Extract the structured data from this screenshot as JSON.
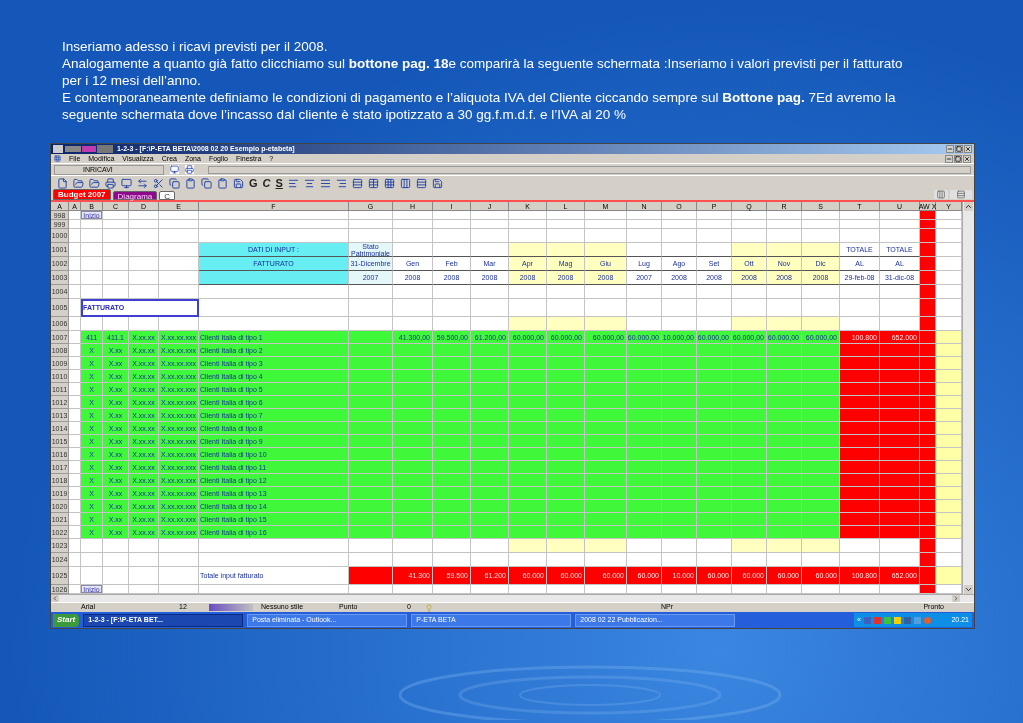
{
  "slide_text": [
    "Inseriamo adesso i ricavi previsti per il 2008.",
    "Analogamente a quanto già fatto clicchiamo sul **bottone pag. 18**e comparirà la seguente schermata :Inseriamo i valori previsti per il fatturato per i 12 mesi dell’anno.",
    "E contemporaneamente definiamo le condizioni di pagamento e l’aliquota IVA del Cliente ciccando sempre sul **Bottone pag.** 7Ed avremo la seguente schermata dove l’incasso dal cliente è stato ipotizzato a 30 gg.f.m.d.f. e l’IVA al 20 %"
  ],
  "window": {
    "title": "1-2-3 - [F:\\P-ETA BETA\\2008 02 20  Esempio p-etabeta]"
  },
  "menu": [
    "File",
    "Modifica",
    "Visualizza",
    "Crea",
    "Zona",
    "Foglio",
    "Finestra",
    "?"
  ],
  "name_box": {
    "value": "INRICAVI"
  },
  "toolbar": {
    "text_buttons": [
      "G",
      "C",
      "S"
    ]
  },
  "sheet_tabs": [
    {
      "label": "Budget 2007",
      "selected": true,
      "color": "#ff0000"
    },
    {
      "label": "Diagrama",
      "selected": false,
      "color": "#8a0a8a"
    },
    {
      "label": "C",
      "selected": false,
      "color": "#ffffff"
    }
  ],
  "corner": "A",
  "columns": [
    "A",
    "B",
    "C",
    "D",
    "E",
    "F",
    "G",
    "H",
    "I",
    "J",
    "K",
    "L",
    "M",
    "N",
    "O",
    "P",
    "Q",
    "R",
    "S",
    "T",
    "U",
    "AW X",
    "Y"
  ],
  "rows": [
    {
      "number": "998",
      "kind": "spacer",
      "button": "Inizio",
      "cells": {}
    },
    {
      "number": "999",
      "kind": "spacer",
      "cells": {}
    },
    {
      "number": "1000",
      "kind": "plain",
      "cells": {}
    },
    {
      "number": "1001",
      "kind": "head",
      "cells": {
        "F": "DATI DI INPUT  :",
        "G": "Stato Patrimoniale",
        "T": "TOTALE",
        "U": "TOTALE"
      }
    },
    {
      "number": "1002",
      "kind": "head",
      "cells": {
        "F": "FATTURATO",
        "G": "31-Dicembre",
        "H": "Gen",
        "I": "Feb",
        "J": "Mar",
        "K": "Apr",
        "L": "Mag",
        "M": "Giu",
        "N": "Lug",
        "O": "Ago",
        "P": "Set",
        "Q": "Ott",
        "R": "Nov",
        "S": "Dic",
        "T": "AL",
        "U": "AL"
      }
    },
    {
      "number": "1003",
      "kind": "head",
      "cells": {
        "G": "2007",
        "H": "2008",
        "I": "2008",
        "J": "2008",
        "K": "2008",
        "L": "2008",
        "M": "2008",
        "N": "2007",
        "O": "2008",
        "P": "2008",
        "Q": "2008",
        "R": "2008",
        "S": "2008",
        "T": "29-feb-08",
        "U": "31-dic-08"
      }
    },
    {
      "number": "1004",
      "kind": "plain",
      "cells": {}
    },
    {
      "number": "1005",
      "kind": "section",
      "cells": {
        "B": "FATTURATO"
      }
    },
    {
      "number": "1006",
      "kind": "gap",
      "cells": {}
    },
    {
      "number": "1007",
      "kind": "input",
      "cells": {
        "B": "411",
        "C": "411.1",
        "D": "X.xx.xx",
        "E": "X.xx.xx.xxx",
        "F": "Clienti Italia di tipo 1",
        "H": "41.300,00",
        "I": "59.500,00",
        "J": "61.200,00",
        "K": "60.000,00",
        "L": "60.000,00",
        "M": "60.000,00",
        "N": "60.000,00",
        "O": "10.000,00",
        "P": "60.000,00",
        "Q": "60.000,00",
        "R": "60.000,00",
        "S": "60.000,00",
        "T": "100.800",
        "U": "652.000"
      }
    },
    {
      "number": "1008",
      "kind": "input",
      "cells": {
        "B": "X",
        "C": "X.xx",
        "D": "X.xx.xx",
        "E": "X.xx.xx.xxx",
        "F": "Clienti Italia di tipo 2"
      }
    },
    {
      "number": "1009",
      "kind": "input",
      "cells": {
        "B": "X",
        "C": "X.xx",
        "D": "X.xx.xx",
        "E": "X.xx.xx.xxx",
        "F": "Clienti Italia di tipo 3"
      }
    },
    {
      "number": "1010",
      "kind": "input",
      "cells": {
        "B": "X",
        "C": "X.xx",
        "D": "X.xx.xx",
        "E": "X.xx.xx.xxx",
        "F": "Clienti Italia di tipo 4"
      }
    },
    {
      "number": "1011",
      "kind": "input",
      "cells": {
        "B": "X",
        "C": "X.xx",
        "D": "X.xx.xx",
        "E": "X.xx.xx.xxx",
        "F": "Clienti Italia di tipo 5"
      }
    },
    {
      "number": "1012",
      "kind": "input",
      "cells": {
        "B": "X",
        "C": "X.xx",
        "D": "X.xx.xx",
        "E": "X.xx.xx.xxx",
        "F": "Clienti Italia di tipo 6"
      }
    },
    {
      "number": "1013",
      "kind": "input",
      "cells": {
        "B": "X",
        "C": "X.xx",
        "D": "X.xx.xx",
        "E": "X.xx.xx.xxx",
        "F": "Clienti Italia di tipo 7"
      }
    },
    {
      "number": "1014",
      "kind": "input",
      "cells": {
        "B": "X",
        "C": "X.xx",
        "D": "X.xx.xx",
        "E": "X.xx.xx.xxx",
        "F": "Clienti Italia di tipo 8"
      }
    },
    {
      "number": "1015",
      "kind": "input",
      "cells": {
        "B": "X",
        "C": "X.xx",
        "D": "X.xx.xx",
        "E": "X.xx.xx.xxx",
        "F": "Clienti Italia di tipo 9"
      }
    },
    {
      "number": "1016",
      "kind": "input",
      "cells": {
        "B": "X",
        "C": "X.xx",
        "D": "X.xx.xx",
        "E": "X.xx.xx.xxx",
        "F": "Clienti Italia di tipo 10"
      }
    },
    {
      "number": "1017",
      "kind": "input",
      "cells": {
        "B": "X",
        "C": "X.xx",
        "D": "X.xx.xx",
        "E": "X.xx.xx.xxx",
        "F": "Clienti Italia di tipo 11"
      }
    },
    {
      "number": "1018",
      "kind": "input",
      "cells": {
        "B": "X",
        "C": "X.xx",
        "D": "X.xx.xx",
        "E": "X.xx.xx.xxx",
        "F": "Clienti Italia di tipo 12"
      }
    },
    {
      "number": "1019",
      "kind": "input",
      "cells": {
        "B": "X",
        "C": "X.xx",
        "D": "X.xx.xx",
        "E": "X.xx.xx.xxx",
        "F": "Clienti Italia di tipo 13"
      }
    },
    {
      "number": "1020",
      "kind": "input",
      "cells": {
        "B": "X",
        "C": "X.xx",
        "D": "X.xx.xx",
        "E": "X.xx.xx.xxx",
        "F": "Clienti Italia di tipo 14"
      }
    },
    {
      "number": "1021",
      "kind": "input",
      "cells": {
        "B": "X",
        "C": "X.xx",
        "D": "X.xx.xx",
        "E": "X.xx.xx.xxx",
        "F": "Clienti Italia di tipo 15"
      }
    },
    {
      "number": "1022",
      "kind": "input",
      "cells": {
        "B": "X",
        "C": "X.xx",
        "D": "X.xx.xx",
        "E": "X.xx.xx.xxx",
        "F": "Clienti Italia di tipo 16"
      }
    },
    {
      "number": "1023",
      "kind": "gap",
      "cells": {}
    },
    {
      "number": "1024",
      "kind": "plain",
      "cells": {}
    },
    {
      "number": "1025",
      "kind": "total",
      "cells": {
        "F": "Totale input fatturato",
        "H": "41.300",
        "I": "59.500",
        "J": "61.200",
        "K": "60.000",
        "L": "60.000",
        "M": "60.000",
        "N": "60.000",
        "O": "10.000",
        "P": "60.000",
        "Q": "60.000",
        "R": "60.000",
        "S": "60.000",
        "T": "100.800",
        "U": "652.000"
      }
    },
    {
      "number": "1026",
      "kind": "spacer",
      "button": "Inizio",
      "cells": {}
    }
  ],
  "format_bar": {
    "font": "Arial",
    "size": "12",
    "style": "Nessuno stile",
    "unit": "Punto",
    "value": "0"
  },
  "status_bar": {
    "mode": "NPr",
    "state": "Pronto"
  },
  "taskbar": {
    "start": "Start",
    "tasks": [
      {
        "label": "1-2-3 - [F:\\P-ETA BET...",
        "selected": true
      },
      {
        "label": "Posta eliminata - Outlook...",
        "selected": false
      },
      {
        "label": "P-ETA BETA",
        "selected": false
      },
      {
        "label": "2008 02 22 Pubblicazion...",
        "selected": false
      }
    ],
    "tray_toggle": "«",
    "clock": "20.21"
  }
}
